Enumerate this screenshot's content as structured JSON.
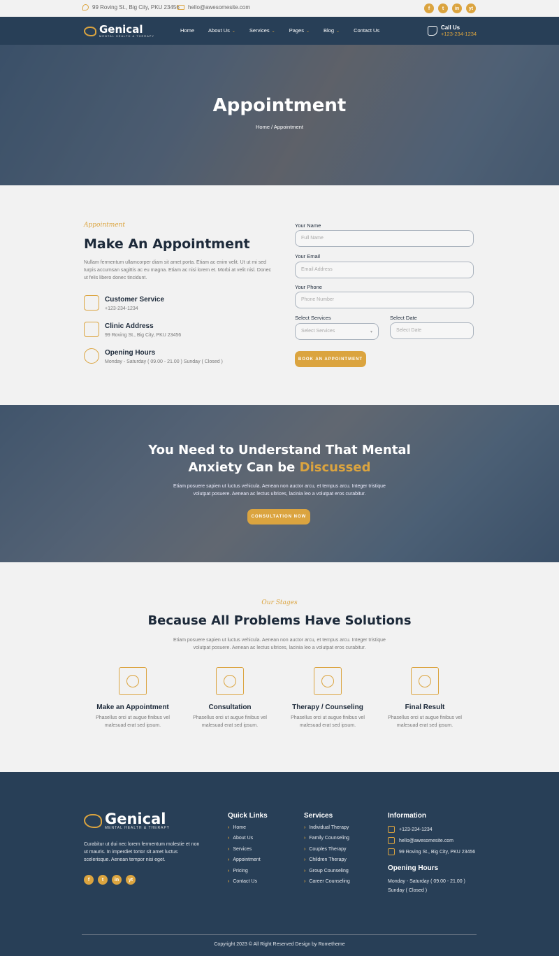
{
  "topbar": {
    "address": "99 Roving St., Big City, PKU 23456",
    "email": "hello@awesomesite.com",
    "social": [
      "f",
      "t",
      "in",
      "yt"
    ]
  },
  "brand": {
    "name": "Genical",
    "tagline": "MENTAL HEALTH & THERAPY"
  },
  "nav": {
    "items": [
      {
        "label": "Home",
        "caret": ""
      },
      {
        "label": "About Us",
        "caret": "⌄"
      },
      {
        "label": "Services",
        "caret": "⌄"
      },
      {
        "label": "Pages",
        "caret": "⌄"
      },
      {
        "label": "Blog",
        "caret": "⌄"
      },
      {
        "label": "Contact Us",
        "caret": ""
      }
    ],
    "call_label": "Call Us",
    "call_number": "+123-234-1234"
  },
  "hero": {
    "title": "Appointment",
    "breadcrumb": "Home / Appointment"
  },
  "appointment": {
    "label": "Appointment",
    "title": "Make An Appointment",
    "description": "Nullam fermentum ullamcorper diam sit amet porta. Etiam ac enim velit. Ut ut mi sed turpis accumsan sagittis ac eu magna. Etiam ac nisi lorem et. Morbi at velit nisl. Donec ut felis libero donec tincidunt.",
    "info": [
      {
        "title": "Customer Service",
        "text": "+123-234-1234"
      },
      {
        "title": "Clinic Address",
        "text": "99 Roving St., Big City, PKU 23456"
      },
      {
        "title": "Opening Hours",
        "text": "Monday - Saturday ( 09.00 - 21.00 ) Sunday ( Closed )"
      }
    ],
    "form": {
      "name_label": "Your Name",
      "name_placeholder": "Full Name",
      "email_label": "Your Email",
      "email_placeholder": "Email Address",
      "phone_label": "Your Phone",
      "phone_placeholder": "Phone Number",
      "services_label": "Select Services",
      "services_value": "Select Services",
      "date_label": "Select Date",
      "date_placeholder": "Select Date",
      "submit": "BOOK AN APPOINTMENT"
    }
  },
  "cta": {
    "title_line1": "You Need to Understand That Mental",
    "title_line2_a": "Anxiety Can be ",
    "title_line2_b": "Discussed",
    "text": "Etiam posuere sapien ut luctus vehicula. Aenean non auctor arcu, et tempus arcu. Integer tristique volutpat posuere. Aenean ac lectus ultrices, lacinia leo a volutpat eros curabitur.",
    "button": "CONSULTATION NOW"
  },
  "stages": {
    "label": "Our Stages",
    "title": "Because All Problems Have Solutions",
    "description": "Etiam posuere sapien ut luctus vehicula. Aenean non auctor arcu, et tempus arcu. Integer tristique volutpat posuere. Aenean ac lectus ultrices, lacinia leo a volutpat eros curabitur.",
    "items": [
      {
        "title": "Make an Appointment",
        "text": "Phasellus orci ut augue finibus vel malesuad erat sed ipsum."
      },
      {
        "title": "Consultation",
        "text": "Phasellus orci ut augue finibus vel malesuad erat sed ipsum."
      },
      {
        "title": "Therapy / Counseling",
        "text": "Phasellus orci ut augue finibus vel malesuad erat sed ipsum."
      },
      {
        "title": "Final Result",
        "text": "Phasellus orci ut augue finibus vel malesuad erat sed ipsum."
      }
    ]
  },
  "footer": {
    "about": "Curabitur ut dui nec lorem fermentum molestie et non ut mauris. In imperdiet tortor sit amet luctus scelerisque. Aenean tempor nisi eget.",
    "quick_links_title": "Quick Links",
    "quick_links": [
      "Home",
      "About Us",
      "Services",
      "Appointment",
      "Pricing",
      "Contact Us"
    ],
    "services_title": "Services",
    "services": [
      "Individual Therapy",
      "Family Counseling",
      "Couples Therapy",
      "Children Therapy",
      "Group Counseling",
      "Career Counseling"
    ],
    "information_title": "Information",
    "phone": "+123-234-1234",
    "email": "hello@awesomesite.com",
    "address": "99 Roving St., Big City, PKU 23456",
    "hours_title": "Opening Hours",
    "hours_line1": "Monday - Saturday ( 09.00 - 21.00 )",
    "hours_line2": "Sunday ( Closed )",
    "copyright": "Copyright 2023 © All Right Reserved Design by Rometheme"
  }
}
